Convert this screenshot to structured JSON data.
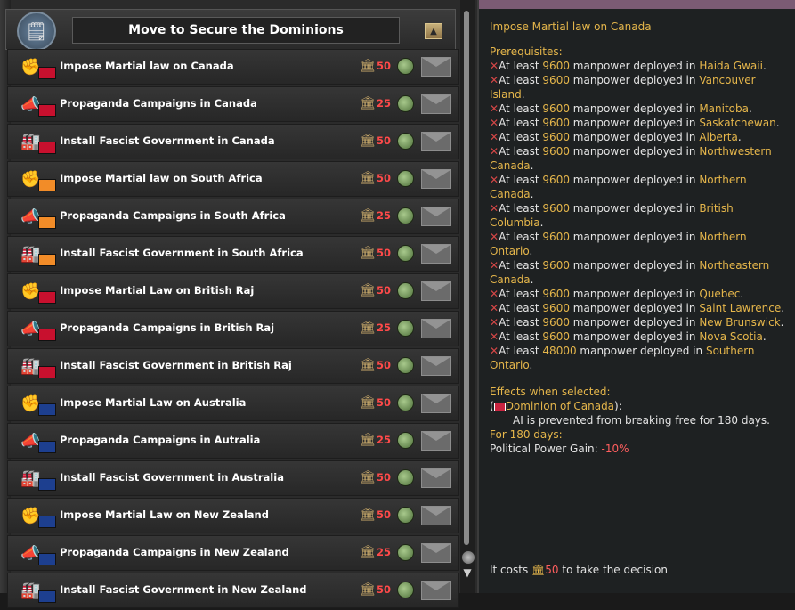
{
  "header": {
    "title": "Move to Secure the Dominions",
    "header_icon": "document-icon"
  },
  "decisions": [
    {
      "title": "Impose Martial law on Canada",
      "cost": "50",
      "kind": "fist",
      "flag": "#c8102e"
    },
    {
      "title": "Propaganda Campaigns in Canada",
      "cost": "25",
      "kind": "megaphone",
      "flag": "#c8102e"
    },
    {
      "title": "Install Fascist Government in Canada",
      "cost": "50",
      "kind": "factory",
      "flag": "#c8102e"
    },
    {
      "title": "Impose Martial law on South Africa",
      "cost": "50",
      "kind": "fist",
      "flag": "#f28c28"
    },
    {
      "title": "Propaganda Campaigns in South Africa",
      "cost": "25",
      "kind": "megaphone",
      "flag": "#f28c28"
    },
    {
      "title": "Install Fascist Government in South Africa",
      "cost": "50",
      "kind": "factory",
      "flag": "#f28c28"
    },
    {
      "title": "Impose Martial Law on British Raj",
      "cost": "50",
      "kind": "fist",
      "flag": "#c8102e"
    },
    {
      "title": "Propaganda Campaigns in British Raj",
      "cost": "25",
      "kind": "megaphone",
      "flag": "#c8102e"
    },
    {
      "title": "Install Fascist Government in British Raj",
      "cost": "50",
      "kind": "factory",
      "flag": "#c8102e"
    },
    {
      "title": "Impose Martial Law on Australia",
      "cost": "50",
      "kind": "fist",
      "flag": "#1d3f8f"
    },
    {
      "title": "Propaganda Campaigns in Autralia",
      "cost": "25",
      "kind": "megaphone",
      "flag": "#1d3f8f"
    },
    {
      "title": "Install Fascist Government in Australia",
      "cost": "50",
      "kind": "factory",
      "flag": "#1d3f8f"
    },
    {
      "title": "Impose Martial Law on New Zealand",
      "cost": "50",
      "kind": "fist",
      "flag": "#1d3f8f"
    },
    {
      "title": "Propaganda Campaigns in New Zealand",
      "cost": "25",
      "kind": "megaphone",
      "flag": "#1d3f8f"
    },
    {
      "title": "Install Fascist Government in New Zealand",
      "cost": "50",
      "kind": "factory",
      "flag": "#1d3f8f"
    }
  ],
  "tooltip": {
    "title": "Impose Martial law on Canada",
    "prerequisites_heading": "Prerequisites:",
    "prerequisites": [
      {
        "pre": "At least ",
        "amount": "9600",
        "mid": " manpower deployed in ",
        "region": "Haida Gwaii",
        "post": "."
      },
      {
        "pre": "At least ",
        "amount": "9600",
        "mid": " manpower deployed in ",
        "region": "Vancouver Island",
        "post": "."
      },
      {
        "pre": "At least ",
        "amount": "9600",
        "mid": " manpower deployed in ",
        "region": "Manitoba",
        "post": "."
      },
      {
        "pre": "At least ",
        "amount": "9600",
        "mid": " manpower deployed in ",
        "region": "Saskatchewan",
        "post": "."
      },
      {
        "pre": "At least ",
        "amount": "9600",
        "mid": " manpower deployed in ",
        "region": "Alberta",
        "post": "."
      },
      {
        "pre": "At least ",
        "amount": "9600",
        "mid": " manpower deployed in ",
        "region": "Northwestern Canada",
        "post": "."
      },
      {
        "pre": "At least ",
        "amount": "9600",
        "mid": " manpower deployed in ",
        "region": "Northern Canada",
        "post": "."
      },
      {
        "pre": "At least ",
        "amount": "9600",
        "mid": " manpower deployed in ",
        "region": "British Columbia",
        "post": "."
      },
      {
        "pre": "At least ",
        "amount": "9600",
        "mid": " manpower deployed in ",
        "region": "Northern Ontario",
        "post": "."
      },
      {
        "pre": "At least ",
        "amount": "9600",
        "mid": " manpower deployed in ",
        "region": "Northeastern Canada",
        "post": "."
      },
      {
        "pre": "At least ",
        "amount": "9600",
        "mid": " manpower deployed in ",
        "region": "Quebec",
        "post": "."
      },
      {
        "pre": "At least ",
        "amount": "9600",
        "mid": " manpower deployed in ",
        "region": "Saint Lawrence",
        "post": "."
      },
      {
        "pre": "At least ",
        "amount": "9600",
        "mid": " manpower deployed in ",
        "region": "New Brunswick",
        "post": "."
      },
      {
        "pre": "At least ",
        "amount": "9600",
        "mid": " manpower deployed in ",
        "region": "Nova Scotia",
        "post": "."
      },
      {
        "pre": "At least ",
        "amount": "48000",
        "mid": " manpower deployed in ",
        "region": "Southern Ontario",
        "post": "."
      }
    ],
    "effects_heading": "Effects when selected:",
    "effect_target": "Dominion of Canada",
    "effect_target_open": "(",
    "effect_target_close": "):",
    "effect_text": "AI is prevented from breaking free for 180 days.",
    "duration": "For 180 days:",
    "political_power_label": "Political Power Gain: ",
    "political_power_value": "-10%",
    "cost_pre": "It costs ",
    "cost_value": "50",
    "cost_post": " to take the decision"
  },
  "colors": {
    "gold": "#e5b64b",
    "red": "#ff5e5e",
    "cost_red": "#ff4a4a",
    "row_bg": "#2e2e2e"
  }
}
